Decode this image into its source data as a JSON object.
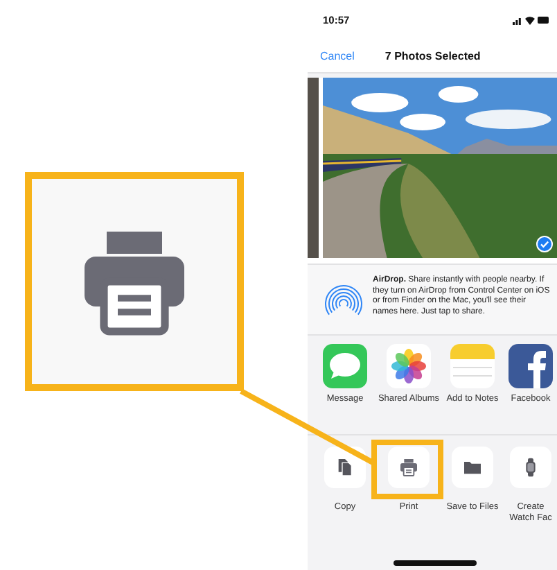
{
  "status_bar": {
    "time": "10:57"
  },
  "header": {
    "cancel": "Cancel",
    "title": "7 Photos Selected"
  },
  "photos": [
    {
      "selected": false
    },
    {
      "selected": true
    }
  ],
  "airdrop": {
    "text": "**AirDrop.** Share instantly with people nearby. If they turn on AirDrop from Control Center on iOS or from Finder on the Mac, you'll see their names here. Just tap to share."
  },
  "apps": [
    {
      "label": "Message",
      "kind": "messages"
    },
    {
      "label": "Shared Albums",
      "kind": "photos"
    },
    {
      "label": "Add to Notes",
      "kind": "notes"
    },
    {
      "label": "Facebook",
      "kind": "facebook"
    }
  ],
  "actions": [
    {
      "label": "Copy",
      "kind": "copy",
      "highlighted": false
    },
    {
      "label": "Print",
      "kind": "print",
      "highlighted": true
    },
    {
      "label": "Save to Files",
      "kind": "folder",
      "highlighted": false
    },
    {
      "label": "Create Watch Fac",
      "kind": "watch",
      "highlighted": false
    }
  ]
}
